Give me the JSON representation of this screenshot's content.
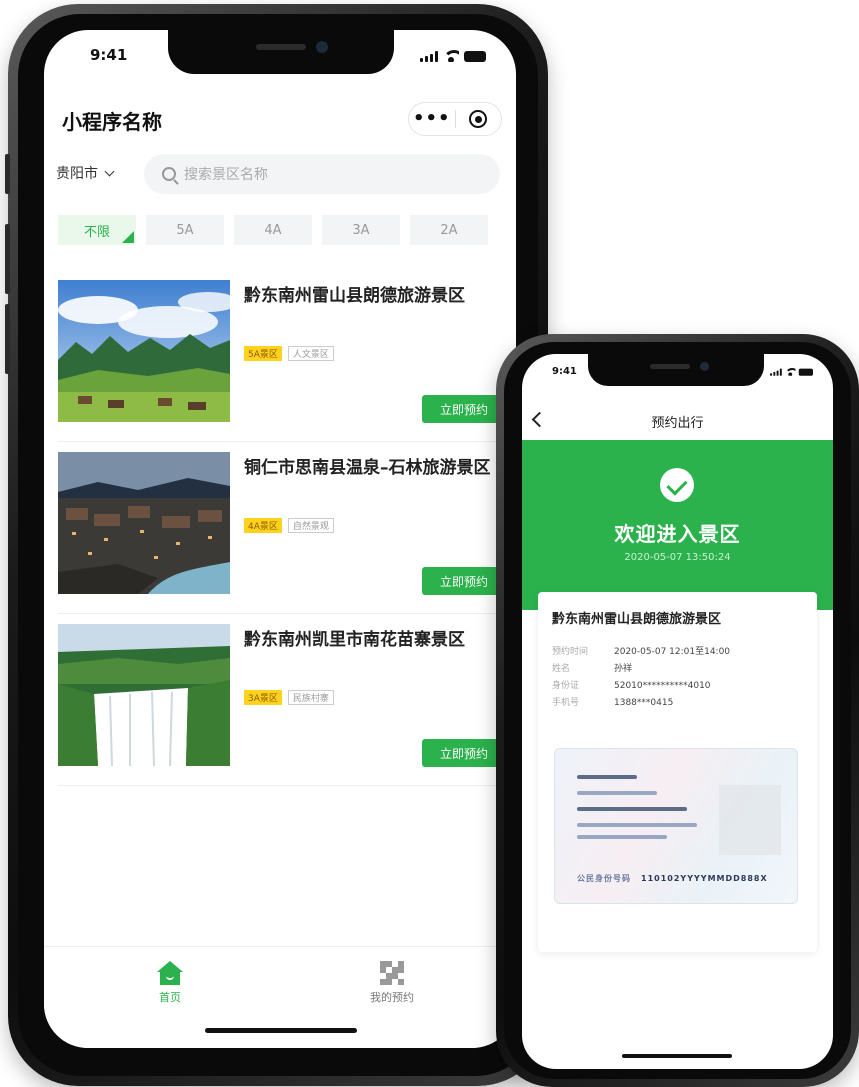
{
  "phone_main": {
    "status": {
      "time": "9:41"
    },
    "mini_program": {
      "title": "小程序名称",
      "more_label": "•••"
    },
    "city": {
      "label": "贵阳市"
    },
    "search": {
      "placeholder": "搜索景区名称"
    },
    "filters": [
      "不限",
      "5A",
      "4A",
      "3A",
      "2A"
    ],
    "spots": [
      {
        "name": "黔东南州雷山县朗德旅游景区",
        "level": "5A景区",
        "type": "人文景区",
        "button": "立即预约"
      },
      {
        "name": "铜仁市思南县温泉–石林旅游景区",
        "level": "4A景区",
        "type": "自然景观",
        "button": "立即预约"
      },
      {
        "name": "黔东南州凯里市南花苗寨景区",
        "level": "3A景区",
        "type": "民族村寨",
        "button": "立即预约"
      }
    ],
    "tabbar": {
      "home": "首页",
      "mine": "我的预约"
    }
  },
  "phone_ticket": {
    "status": {
      "time": "9:41"
    },
    "nav_title": "预约出行",
    "welcome": "欢迎进入景区",
    "timestamp": "2020-05-07 13:50:24",
    "spot_name": "黔东南州雷山县朗德旅游景区",
    "details": [
      {
        "key": "预约时间",
        "value": "2020-05-07 12:01至14:00"
      },
      {
        "key": "姓名",
        "value": "孙祥"
      },
      {
        "key": "身份证",
        "value": "52010**********4010"
      },
      {
        "key": "手机号",
        "value": "1388***0415"
      }
    ],
    "id_card": {
      "label": "公民身份号码",
      "number": "110102YYYYMMDD888X"
    }
  },
  "colors": {
    "brand_green": "#2bb24c",
    "level_tag": "#ffd21e"
  }
}
